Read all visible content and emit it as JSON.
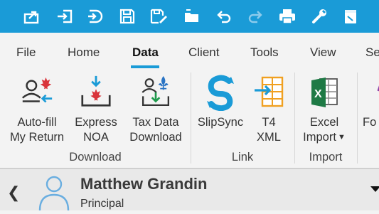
{
  "quick_access": [
    {
      "icon": "export-icon"
    },
    {
      "icon": "import-icon"
    },
    {
      "icon": "return-icon"
    },
    {
      "icon": "save-icon"
    },
    {
      "icon": "save-as-icon"
    },
    {
      "icon": "open-folder-icon"
    },
    {
      "icon": "undo-icon"
    },
    {
      "icon": "redo-icon"
    },
    {
      "icon": "print-icon"
    },
    {
      "icon": "wrench-icon"
    },
    {
      "icon": "notepad-icon"
    }
  ],
  "menu": {
    "tabs": [
      "File",
      "Home",
      "Data",
      "Client",
      "Tools",
      "View",
      "Se"
    ],
    "active": "Data"
  },
  "ribbon": {
    "buttons": {
      "autofill": {
        "line1": "Auto-fill",
        "line2": "My Return",
        "icon": "autofill-user-icon"
      },
      "express_noa": {
        "line1": "Express",
        "line2": "NOA",
        "icon": "noa-download-icon"
      },
      "tax_data": {
        "line1": "Tax Data",
        "line2": "Download",
        "icon": "tax-data-download-icon"
      },
      "slipsync": {
        "line1": "SlipSync",
        "icon": "slipsync-icon"
      },
      "t4xml": {
        "line1": "T4",
        "line2": "XML",
        "icon": "t4-xml-icon"
      },
      "excel_import": {
        "line1": "Excel",
        "line2": "Import",
        "icon": "excel-icon"
      },
      "partial": {
        "line1": "Fo"
      }
    },
    "groups": {
      "download": "Download",
      "link": "Link",
      "import": "Import"
    }
  },
  "client": {
    "name": "Matthew Grandin",
    "role": "Principal"
  },
  "colors": {
    "accent": "#1a9bd7",
    "maple_red": "#d9343b",
    "fleur_blue": "#2a74c4",
    "excel_green": "#1e7a45",
    "t4_orange": "#f0a020"
  }
}
